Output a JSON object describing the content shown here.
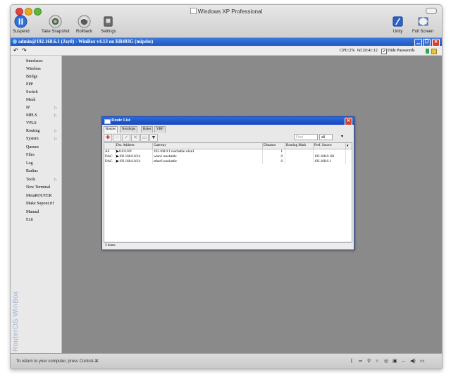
{
  "mac": {
    "title": "Windows XP Professional",
    "toolbar": [
      {
        "label": "Suspend",
        "icon": "pause-icon"
      },
      {
        "label": "Take Snapshot",
        "icon": "camera-icon"
      },
      {
        "label": "Rollback",
        "icon": "rollback-icon"
      },
      {
        "label": "Settings",
        "icon": "settings-icon"
      }
    ],
    "right_toolbar": [
      {
        "label": "Unity",
        "icon": "unity-icon"
      },
      {
        "label": "Full Screen",
        "icon": "fullscreen-icon"
      }
    ]
  },
  "winbox": {
    "title": "admin@192.168.6.1 (Jay8) - WinBox v4.13 on RB493G (mipsbe)",
    "cpu": "CPU:2%",
    "time": "6d 20:41:12",
    "hide_passwords": "Hide Passwords",
    "hide_passwords_checked": true,
    "brand": "RouterOS WinBox",
    "menu": [
      {
        "label": "Interfaces",
        "arrow": false
      },
      {
        "label": "Wireless",
        "arrow": false
      },
      {
        "label": "Bridge",
        "arrow": false
      },
      {
        "label": "PPP",
        "arrow": false
      },
      {
        "label": "Switch",
        "arrow": false
      },
      {
        "label": "Mesh",
        "arrow": false
      },
      {
        "label": "IP",
        "arrow": true
      },
      {
        "label": "MPLS",
        "arrow": true
      },
      {
        "label": "VPLS",
        "arrow": false
      },
      {
        "label": "Routing",
        "arrow": true
      },
      {
        "label": "System",
        "arrow": true
      },
      {
        "label": "Queues",
        "arrow": false
      },
      {
        "label": "Files",
        "arrow": false
      },
      {
        "label": "Log",
        "arrow": false
      },
      {
        "label": "Radius",
        "arrow": false
      },
      {
        "label": "Tools",
        "arrow": true
      },
      {
        "label": "New Terminal",
        "arrow": false
      },
      {
        "label": "MetaROUTER",
        "arrow": false
      },
      {
        "label": "Make Supout.rif",
        "arrow": false
      },
      {
        "label": "Manual",
        "arrow": false
      },
      {
        "label": "Exit",
        "arrow": false
      }
    ]
  },
  "route_list": {
    "title": "Route List",
    "tabs": [
      "Routes",
      "Nexthops",
      "Rules",
      "VRF"
    ],
    "find_placeholder": "Find",
    "filter_value": "all",
    "columns": [
      "",
      "Dst. Address",
      "Gateway",
      "Distance",
      "Routing Mark",
      "Pref. Source"
    ],
    "rows": [
      {
        "flags": "AS",
        "dst": "0.0.0.0/0",
        "gateway": "192.168.0.1 reachable wlan1",
        "distance": "1",
        "mark": "",
        "pref": ""
      },
      {
        "flags": "DAC",
        "dst": "192.168.0.0/24",
        "gateway": "wlan1 reachable",
        "distance": "0",
        "mark": "",
        "pref": "192.168.0.101"
      },
      {
        "flags": "DAC",
        "dst": "192.168.6.0/24",
        "gateway": "ether6 reachable",
        "distance": "0",
        "mark": "",
        "pref": "192.168.6.1"
      }
    ],
    "footer": "3 items"
  },
  "statusbar": {
    "text": "To return to your computer, press Control-⌘"
  }
}
